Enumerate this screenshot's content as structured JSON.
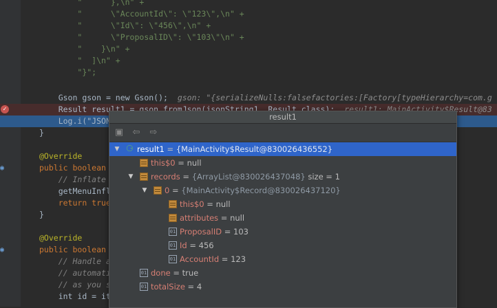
{
  "code_lines": [
    {
      "t": "str",
      "s": "\"      },\\n\" +"
    },
    {
      "t": "str",
      "s": "\"      \\\"AccountId\\\": \\\"123\\\",\\n\" +"
    },
    {
      "t": "str",
      "s": "\"      \\\"Id\\\": \\\"456\\\",\\n\" +"
    },
    {
      "t": "str",
      "s": "\"      \\\"ProposalID\\\": \\\"103\\\"\\n\" +"
    },
    {
      "t": "str",
      "s": "\"    }\\n\" +"
    },
    {
      "t": "str",
      "s": "\"  ]\\n\" +"
    },
    {
      "t": "str",
      "s": "\"}\";"
    }
  ],
  "gson_line": {
    "code": "Gson gson = new Gson();",
    "hint": "gson: \"{serializeNulls:falsefactories:[Factory[typeHierarchy=com.g"
  },
  "result_line": {
    "code": "Result result1 = gson.fromJson(jsonString1, Result.class);",
    "hint": "result1: MainActivity$Result@83"
  },
  "log_line": "Log.i(\"JSON",
  "close_brace": "}",
  "override": "@Override",
  "menu_sig": "public boolean",
  "menu_c1": "// Inflate",
  "menu_l2": "getMenuInfl",
  "menu_l3": "return true",
  "opt_c1": "// Handle a",
  "opt_c2": "// automati",
  "opt_c3": "// as you s",
  "opt_l4": "int id = it",
  "popup": {
    "title": "result1",
    "tree": [
      {
        "name": "result1",
        "eq": " = ",
        "val": "{MainActivity$Result@830026436552}",
        "ref": true,
        "icon": "watch",
        "expand": "down",
        "depth": 0
      },
      {
        "name": "this$0",
        "eq": " = ",
        "val": "null",
        "ref": false,
        "icon": "field",
        "expand": "",
        "depth": 1
      },
      {
        "name": "records",
        "eq": " = ",
        "val": "{ArrayList@830026437048}",
        "ref": true,
        "extra": "  size = 1",
        "icon": "field",
        "expand": "down",
        "depth": 1
      },
      {
        "name": "0",
        "eq": " = ",
        "val": "{MainActivity$Record@830026437120}",
        "ref": true,
        "icon": "field",
        "expand": "down",
        "depth": 2
      },
      {
        "name": "this$0",
        "eq": " = ",
        "val": "null",
        "ref": false,
        "icon": "field",
        "expand": "",
        "depth": 3
      },
      {
        "name": "attributes",
        "eq": " = ",
        "val": "null",
        "ref": false,
        "icon": "field",
        "expand": "",
        "depth": 3
      },
      {
        "name": "ProposalID",
        "eq": " = ",
        "val": "103",
        "ref": false,
        "icon": "prim",
        "expand": "",
        "depth": 3
      },
      {
        "name": "Id",
        "eq": " = ",
        "val": "456",
        "ref": false,
        "icon": "prim",
        "expand": "",
        "depth": 3
      },
      {
        "name": "AccountId",
        "eq": " = ",
        "val": "123",
        "ref": false,
        "icon": "prim",
        "expand": "",
        "depth": 3
      },
      {
        "name": "done",
        "eq": " = ",
        "val": "true",
        "ref": false,
        "icon": "prim",
        "expand": "",
        "depth": 1
      },
      {
        "name": "totalSize",
        "eq": " = ",
        "val": "4",
        "ref": false,
        "icon": "prim",
        "expand": "",
        "depth": 1
      }
    ]
  }
}
